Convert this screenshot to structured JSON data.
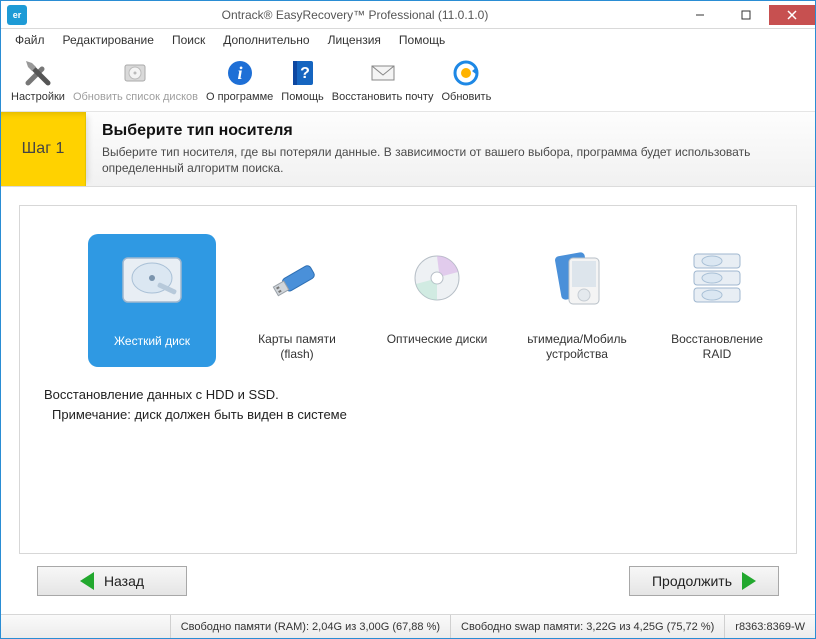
{
  "window": {
    "title": "Ontrack® EasyRecovery™ Professional (11.0.1.0)",
    "icon_text": "er"
  },
  "menu": {
    "file": "Файл",
    "edit": "Редактирование",
    "search": "Поиск",
    "advanced": "Дополнительно",
    "license": "Лицензия",
    "help": "Помощь"
  },
  "toolbar": {
    "settings": "Настройки",
    "refresh_disks": "Обновить список дисков",
    "about": "О программе",
    "help": "Помощь",
    "recover_mail": "Восстановить почту",
    "update": "Обновить"
  },
  "step": {
    "badge": "Шаг 1",
    "title": "Выберите тип носителя",
    "desc": "Выберите тип носителя, где вы потеряли данные. В зависимости от вашего выбора, программа будет использовать определенный алгоритм поиска."
  },
  "tiles": {
    "hdd": "Жесткий диск",
    "flash": "Карты памяти (flash)",
    "optical": "Оптические диски",
    "mobile": "ьтимедиа/Мобиль устройства",
    "raid": "Восстановление RAID"
  },
  "selection_desc": {
    "line1": "Восстановление данных с HDD и SSD.",
    "line2": "Примечание: диск должен быть виден в системе"
  },
  "nav": {
    "back": "Назад",
    "next": "Продолжить"
  },
  "status": {
    "ram": "Свободно памяти (RAM): 2,04G из 3,00G (67,88 %)",
    "swap": "Свободно swap памяти: 3,22G из 4,25G (75,72 %)",
    "build": "r8363:8369-W"
  }
}
